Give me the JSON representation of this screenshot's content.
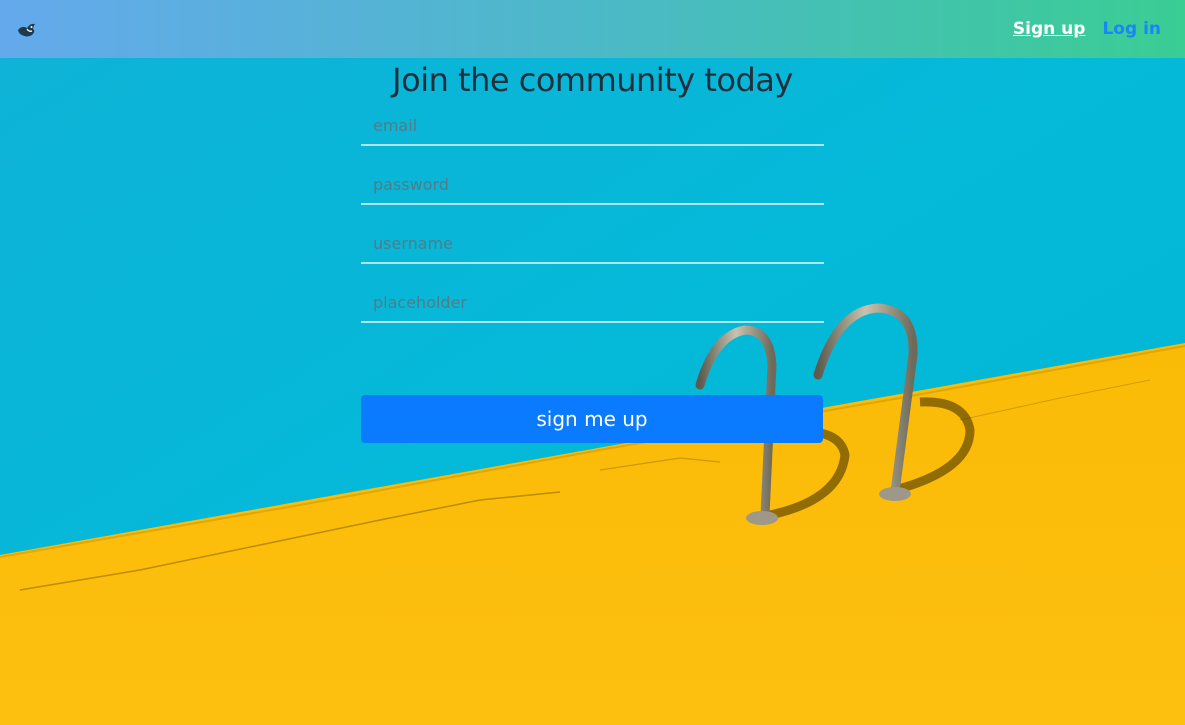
{
  "nav": {
    "logo_icon": "bird-logo-icon",
    "signup_label": "Sign up",
    "login_label": "Log in"
  },
  "form": {
    "title": "Join the community today",
    "email_placeholder": "email",
    "password_placeholder": "password",
    "username_placeholder": "username",
    "extra_placeholder": "placeholder",
    "submit_label": "sign me up"
  },
  "colors": {
    "navbar_gradient_start": "#64a9ec",
    "navbar_gradient_end": "#3acd94",
    "login_link": "#1787f5",
    "submit_button": "#0a7afe",
    "pool_water": "#05b6d4",
    "pool_deck": "#fbbd08"
  }
}
